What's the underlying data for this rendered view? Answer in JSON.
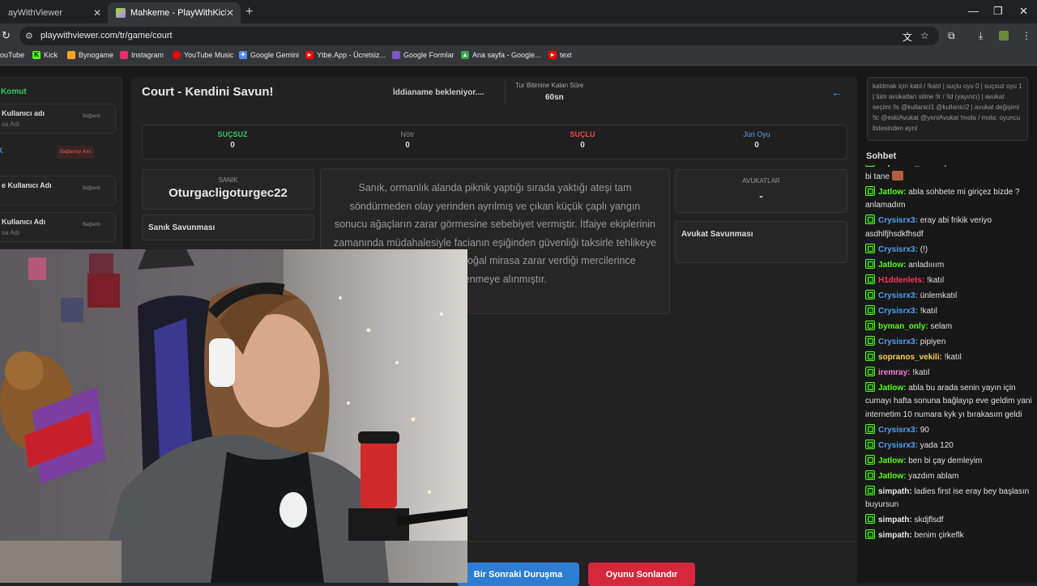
{
  "browser": {
    "tabs": [
      {
        "title": "ayWithViewer"
      },
      {
        "title": "Mahkeme - PlayWithKick | Play"
      }
    ],
    "url": "playwithviewer.com/tr/game/court",
    "bookmarks": [
      {
        "label": "ouTube",
        "icon": "youtube-icon",
        "color": "#ff0000"
      },
      {
        "label": "Kick",
        "icon": "kick-icon",
        "color": "#53fc18"
      },
      {
        "label": "Bynogame",
        "icon": "bynogame-icon",
        "color": "#f5a623"
      },
      {
        "label": "Instagram",
        "icon": "instagram-icon",
        "color": "#e1306c"
      },
      {
        "label": "YouTube Music",
        "icon": "youtube-music-icon",
        "color": "#ff0000"
      },
      {
        "label": "Google Gemini",
        "icon": "gemini-icon",
        "color": "#4e8cf0"
      },
      {
        "label": "Ytbe.App - Ücretsiz...",
        "icon": "youtube-icon",
        "color": "#ff0000"
      },
      {
        "label": "Google Formlar",
        "icon": "forms-icon",
        "color": "#7e57c2"
      },
      {
        "label": "Ana sayfa - Google...",
        "icon": "drive-icon",
        "color": "#34a853"
      },
      {
        "label": "text",
        "icon": "youtube-icon",
        "color": "#ff0000"
      }
    ]
  },
  "leftpanel": {
    "title": "Komut",
    "items": [
      {
        "name": "Kullanıcı adı",
        "sub": "sa Adı",
        "btn": "Bağlantı"
      },
      {
        "name": "e Kullanıcı Adı",
        "sub": "",
        "btn": "Bağlantı"
      },
      {
        "name": "Kullanıcı Adı",
        "sub": "sa Adı",
        "btn": "Bağlantı"
      }
    ],
    "row2_label": "K",
    "row2_btn": "Bağlantıyı Kes"
  },
  "court": {
    "title": "Court - Kendini Savun!",
    "status": "İddianame bekleniyor....",
    "timer_label": "Tur Bitimine Kalan Süre",
    "timer_value": "60sn",
    "votes": [
      {
        "label": "SUÇSUZ",
        "value": "0",
        "color": "#32c864"
      },
      {
        "label": "Nötr",
        "value": "0",
        "color": "#888888"
      },
      {
        "label": "SUÇLU",
        "value": "0",
        "color": "#f04848"
      },
      {
        "label": "Jüri Oyu",
        "value": "0",
        "color": "#4ea1f3"
      }
    ],
    "defendant_label": "SANIK",
    "defendant_name": "Oturgacligoturgec22",
    "defendant_defense": "Sanık Savunması",
    "indictment": "Sanık, ormanlık alanda piknik yaptığı sırada yaktığı ateşi tam söndürmeden olay yerinden ayrılmış ve çıkan küçük çaplı yangın sonucu ağaçların zarar görmesine sebebiyet vermiştir. İtfaiye ekiplerinin zamanında müdahalesiyle facianın eşiğinden güvenliği taksirle tehlikeye soktuğu ve eket ederek doğal mirasa zarar verdiği mercilerince incelenmeye alınmıştır.",
    "lawyers_label": "AVUKATLAR",
    "lawyers_value": "-",
    "lawyer_defense": "Avukat Savunması",
    "next_button": "Bir Sonraki Duruşma",
    "end_button": "Oyunu Sonlandır"
  },
  "chat": {
    "commands": "katılmak için katıl / !katıl | suçlu oyu 0 | suçsuz oyu 1 | tüm avukatları silme !lr / !ld (yayıncı) | avukat seçimi !ls @kullanici1 @kullanici2 | avukat değişimi !lc @eskiAvukat @yeniAvukat !mola / mola: oyuncu listesinden ayrıl",
    "title": "Sohbet",
    "messages": [
      {
        "user": "sopranos_vekili",
        "color": "#ffd24a",
        "text": "printscreen linki atım mi bi tane",
        "emote": true
      },
      {
        "user": "Jatlow",
        "color": "#53fc18",
        "text": "abla sohbete mi giriçez bizde ? anlamadım"
      },
      {
        "user": "Crysisrx3",
        "color": "#4ea1f3",
        "text": "eray abi frikik veriyo asdhlfjhsdkfhsdf"
      },
      {
        "user": "Crysisrx3",
        "color": "#4ea1f3",
        "text": "(!)"
      },
      {
        "user": "Jatlow",
        "color": "#53fc18",
        "text": "anladıııım"
      },
      {
        "user": "H1ddenlets",
        "color": "#ff3355",
        "text": "!katıl"
      },
      {
        "user": "Crysisrx3",
        "color": "#4ea1f3",
        "text": "ünlemkatıl"
      },
      {
        "user": "Crysisrx3",
        "color": "#4ea1f3",
        "text": "!katıl"
      },
      {
        "user": "byman_only",
        "color": "#53fc18",
        "text": "selam"
      },
      {
        "user": "Crysisrx3",
        "color": "#4ea1f3",
        "text": "pipiyen"
      },
      {
        "user": "sopranos_vekili",
        "color": "#ffd24a",
        "text": "!katıl"
      },
      {
        "user": "iremray",
        "color": "#ff7ad9",
        "text": "!katıl"
      },
      {
        "user": "Jatlow",
        "color": "#53fc18",
        "text": "abla bu arada senin yayın için cumayı hafta sonuna bağlayıp eve geldim yani internetim 10 numara kyk yı bırakasım geldi"
      },
      {
        "user": "Crysisrx3",
        "color": "#4ea1f3",
        "text": "90"
      },
      {
        "user": "Crysisrx3",
        "color": "#4ea1f3",
        "text": "yada 120"
      },
      {
        "user": "Jatlow",
        "color": "#53fc18",
        "text": "ben bi çay demleyim"
      },
      {
        "user": "Jatlow",
        "color": "#53fc18",
        "text": "yazdım ablam"
      },
      {
        "user": "simpath",
        "color": "#e8e8e8",
        "text": "ladies first ise eray bey başlasın buyursun"
      },
      {
        "user": "simpath",
        "color": "#e8e8e8",
        "text": "skdjflsdf"
      },
      {
        "user": "simpath",
        "color": "#e8e8e8",
        "text": "benim çirkeflk"
      }
    ]
  }
}
